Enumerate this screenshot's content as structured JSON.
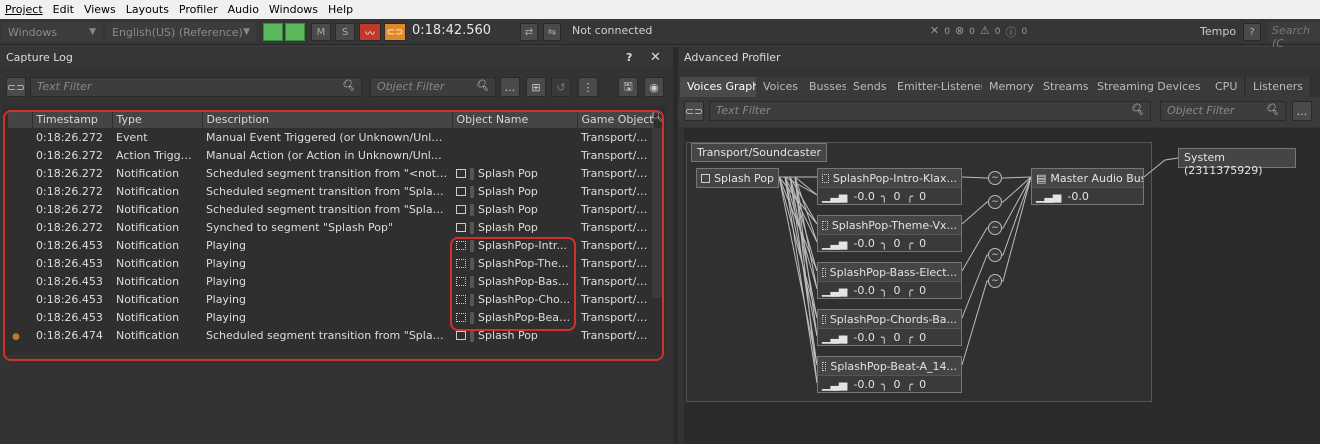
{
  "menu": [
    "Project",
    "Edit",
    "Views",
    "Layouts",
    "Profiler",
    "Audio",
    "Windows",
    "Help"
  ],
  "toolbar": {
    "platform": "Windows",
    "language": "English(US) (Reference)",
    "m_label": "M",
    "s_label": "S",
    "timecode": "0:18:42.560",
    "connection": "Not connected",
    "counts": {
      "close": "0",
      "error": "0",
      "warning": "0",
      "info": "0"
    },
    "tempo": "Tempo",
    "help": "?",
    "search_placeholder": "Search (C"
  },
  "capture_log": {
    "title": "Capture Log",
    "help": "?",
    "close": "✕",
    "text_filter": "Text Filter",
    "object_filter": "Object Filter",
    "more": "...",
    "columns": [
      "Timestamp",
      "Type",
      "Description",
      "Object Name",
      "Game Object N"
    ],
    "rows": [
      {
        "ts": "0:18:26.272",
        "type": "Event",
        "desc": "Manual Event Triggered (or Unknown/Unloaded ...",
        "obj": "",
        "game": "Transport/Sou",
        "icon": ""
      },
      {
        "ts": "0:18:26.272",
        "type": "Action Triggered",
        "desc": "Manual Action (or Action in Unknown/Unloaded ...",
        "obj": "",
        "game": "Transport/Sou",
        "icon": ""
      },
      {
        "ts": "0:18:26.272",
        "type": "Notification",
        "desc": "Scheduled segment transition from \"<nothing>...",
        "obj": "Splash Pop",
        "game": "Transport/Sou",
        "icon": "seq"
      },
      {
        "ts": "0:18:26.272",
        "type": "Notification",
        "desc": "Scheduled segment transition from \"Splash Pop...",
        "obj": "Splash Pop",
        "game": "Transport/Sou",
        "icon": "seq"
      },
      {
        "ts": "0:18:26.272",
        "type": "Notification",
        "desc": "Scheduled segment transition from \"Splash Pop...",
        "obj": "Splash Pop",
        "game": "Transport/Sou",
        "icon": "seq"
      },
      {
        "ts": "0:18:26.272",
        "type": "Notification",
        "desc": "Synched to segment \"Splash Pop\"",
        "obj": "Splash Pop",
        "game": "Transport/Sou",
        "icon": "seq"
      },
      {
        "ts": "0:18:26.453",
        "type": "Notification",
        "desc": "Playing",
        "obj": "SplashPop-Intr...",
        "game": "Transport/Sou",
        "icon": "trk"
      },
      {
        "ts": "0:18:26.453",
        "type": "Notification",
        "desc": "Playing",
        "obj": "SplashPop-The...",
        "game": "Transport/Sou",
        "icon": "trk"
      },
      {
        "ts": "0:18:26.453",
        "type": "Notification",
        "desc": "Playing",
        "obj": "SplashPop-Bass...",
        "game": "Transport/Sou",
        "icon": "trk"
      },
      {
        "ts": "0:18:26.453",
        "type": "Notification",
        "desc": "Playing",
        "obj": "SplashPop-Cho...",
        "game": "Transport/Sou",
        "icon": "trk"
      },
      {
        "ts": "0:18:26.453",
        "type": "Notification",
        "desc": "Playing",
        "obj": "SplashPop-Beat...",
        "game": "Transport/Sou",
        "icon": "trk"
      },
      {
        "ts": "0:18:26.474",
        "type": "Notification",
        "desc": "Scheduled segment transition from \"Splash Pop...",
        "obj": "Splash Pop",
        "game": "Transport/Sou",
        "icon": "seq",
        "marker": true
      }
    ]
  },
  "profiler": {
    "title": "Advanced Profiler",
    "tabs": [
      "Voices Graph",
      "Voices",
      "Busses",
      "Sends",
      "Emitter-Listener",
      "Memory",
      "Streams",
      "Streaming Devices",
      "CPU",
      "Listeners"
    ],
    "text_filter": "Text Filter",
    "object_filter": "Object Filter",
    "more": "...",
    "graph": {
      "group_label": "Transport/Soundcaster",
      "root": "Splash Pop",
      "voices": [
        {
          "name": "SplashPop-Intro-Klax...",
          "vol": "-0.0",
          "lpf": "0",
          "hpf": "0"
        },
        {
          "name": "SplashPop-Theme-Vx...",
          "vol": "-0.0",
          "lpf": "0",
          "hpf": "0"
        },
        {
          "name": "SplashPop-Bass-Elect...",
          "vol": "-0.0",
          "lpf": "0",
          "hpf": "0"
        },
        {
          "name": "SplashPop-Chords-Ba...",
          "vol": "-0.0",
          "lpf": "0",
          "hpf": "0"
        },
        {
          "name": "SplashPop-Beat-A_14...",
          "vol": "-0.0",
          "lpf": "0",
          "hpf": "0"
        }
      ],
      "bus": {
        "name": "Master Audio Bus",
        "vol": "-0.0"
      },
      "system": "System (2311375929)"
    }
  }
}
